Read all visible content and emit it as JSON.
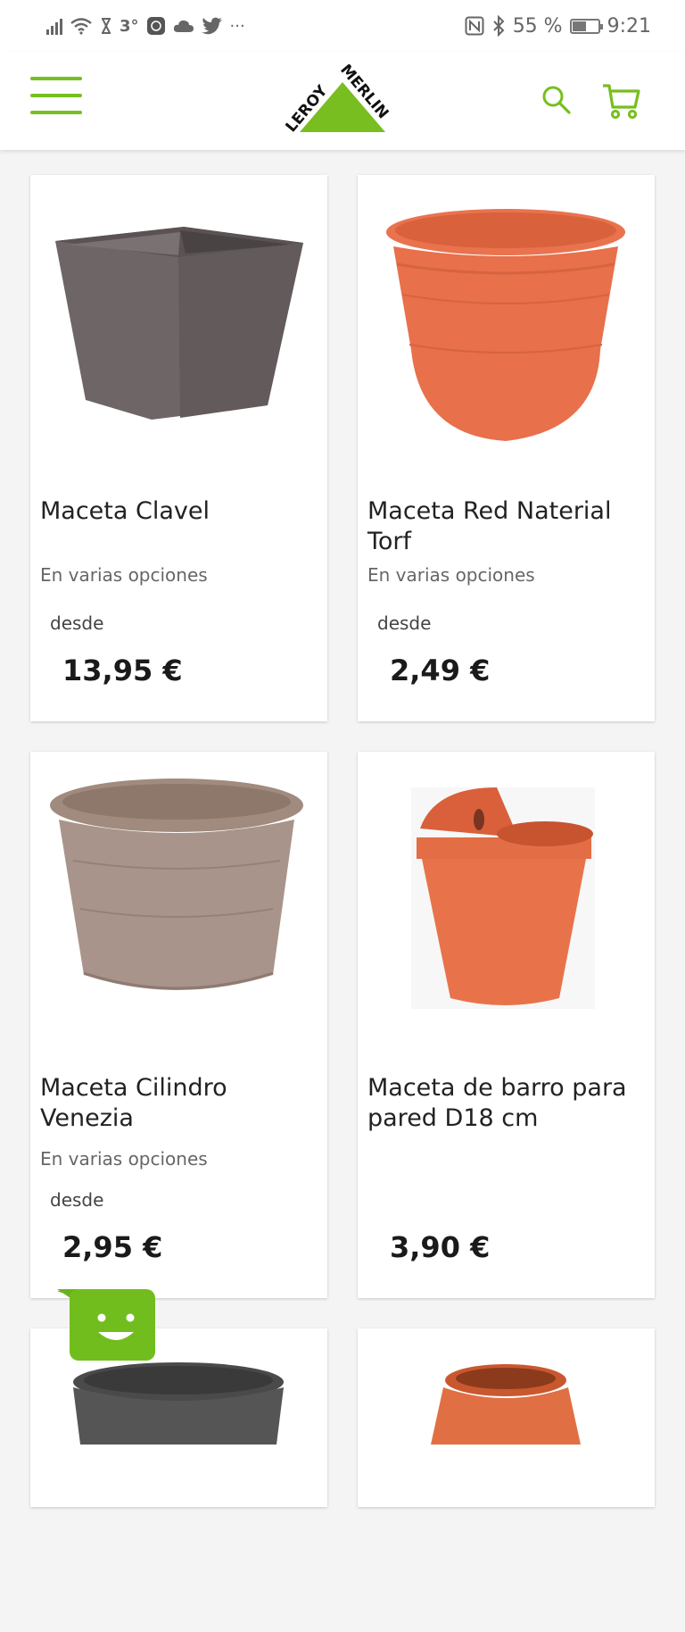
{
  "status_bar": {
    "temperature": "3°",
    "battery": "55 %",
    "battery_level": 0.55,
    "time": "9:21",
    "more": "···"
  },
  "header": {
    "logo_text": "LEROY MERLIN",
    "brand_color": "#78be20"
  },
  "products": [
    {
      "name": "Maceta Clavel",
      "subtitle": "En varias opciones",
      "desde": "desde",
      "price": "13,95 €"
    },
    {
      "name": "Maceta Red Naterial Torf",
      "subtitle": "En varias opciones",
      "desde": "desde",
      "price": "2,49 €"
    },
    {
      "name": "Maceta Cilindro Venezia",
      "subtitle": "En varias opciones",
      "desde": "desde",
      "price": "2,95 €"
    },
    {
      "name": "Maceta de barro para pared D18 cm",
      "price": "3,90 €"
    }
  ]
}
